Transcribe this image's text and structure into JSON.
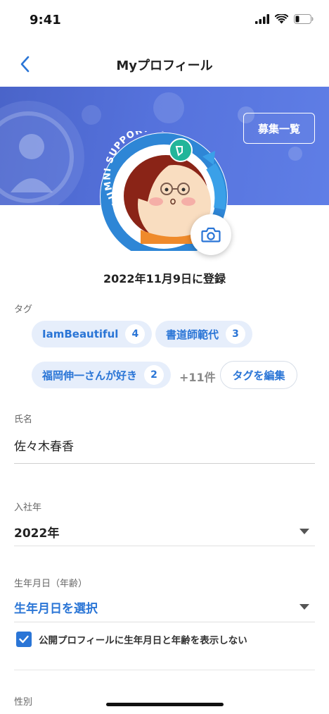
{
  "status_bar": {
    "time": "9:41"
  },
  "nav": {
    "title": "Myプロフィール"
  },
  "banner": {
    "recruit_label": "募集一覧"
  },
  "avatar": {
    "badge_text": "ALUMNI SUPPORTER"
  },
  "profile": {
    "registered": "2022年11月9日に登録"
  },
  "tags": {
    "label": "タグ",
    "items": [
      {
        "name": "IamBeautiful",
        "count": "4"
      },
      {
        "name": "書道師範代",
        "count": "3"
      },
      {
        "name": "福岡伸一さんが好き",
        "count": "2"
      }
    ],
    "more": "+11件",
    "edit_label": "タグを編集"
  },
  "name_field": {
    "label": "氏名",
    "value": "佐々木春香"
  },
  "join_year": {
    "label": "入社年",
    "value": "2022年"
  },
  "birthday": {
    "label": "生年月日（年齢）",
    "value": "生年月日を選択",
    "hide_checkbox_label": "公開プロフィールに生年月日と年齢を表示しない",
    "hide_checked": true
  },
  "gender": {
    "label": "性別"
  },
  "colors": {
    "accent": "#2a75d6",
    "banner": "#5572dc",
    "chip_bg": "#e6eefb"
  }
}
